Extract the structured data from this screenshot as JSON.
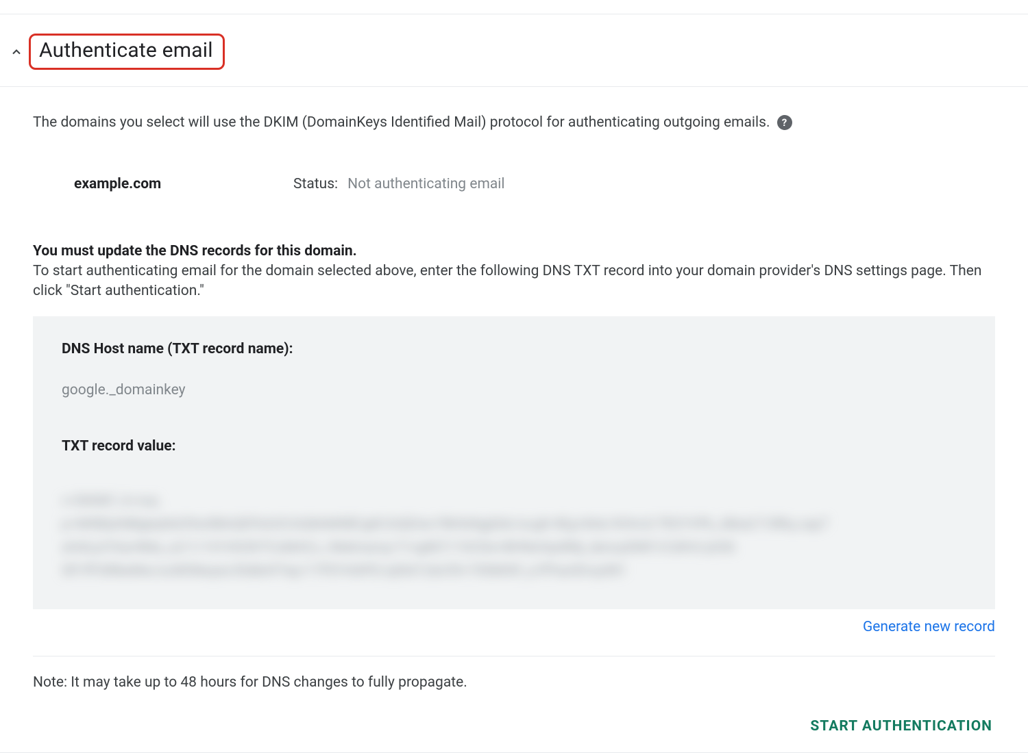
{
  "section": {
    "title": "Authenticate email"
  },
  "main": {
    "intro_text": "The domains you select will use the DKIM (DomainKeys Identified Mail) protocol for authenticating outgoing emails.",
    "domain": "example.com",
    "status_label": "Status:",
    "status_value": "Not authenticating email",
    "instructions_heading": "You must update the DNS records for this domain.",
    "instructions_body": "To start authenticating email for the domain selected above, enter the following DNS TXT record into your domain provider's DNS settings page. Then click \"Start authentication.\"",
    "dns": {
      "host_label": "DNS Host name (TXT record name):",
      "host_value": "google._domainkey",
      "txt_label": "TXT record value:"
    },
    "generate_link": "Generate new record",
    "note": "Note: It may take up to 48 hours for DNS changes to fully propagate.",
    "start_button": "START AUTHENTICATION"
  }
}
